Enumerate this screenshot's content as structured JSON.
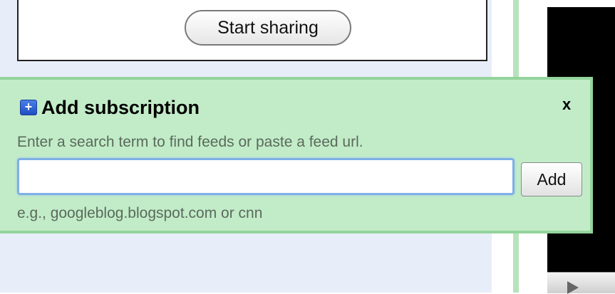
{
  "share": {
    "button_label": "Start sharing"
  },
  "subscription_popup": {
    "title": "Add subscription",
    "close_label": "x",
    "hint": "Enter a search term to find feeds or paste a feed url.",
    "input_value": "",
    "input_placeholder": "",
    "add_button_label": "Add",
    "example": "e.g., googleblog.blogspot.com or cnn",
    "plus_icon_glyph": "+"
  },
  "colors": {
    "popup_bg": "#c2ecc8",
    "popup_border": "#94d39d",
    "left_panel_bg": "#e8eef9",
    "input_focus": "#7fb0e6",
    "plus_icon": "#2b5fd6"
  },
  "icons": {
    "add": "plus-icon",
    "close": "close-icon",
    "play": "play-icon"
  }
}
